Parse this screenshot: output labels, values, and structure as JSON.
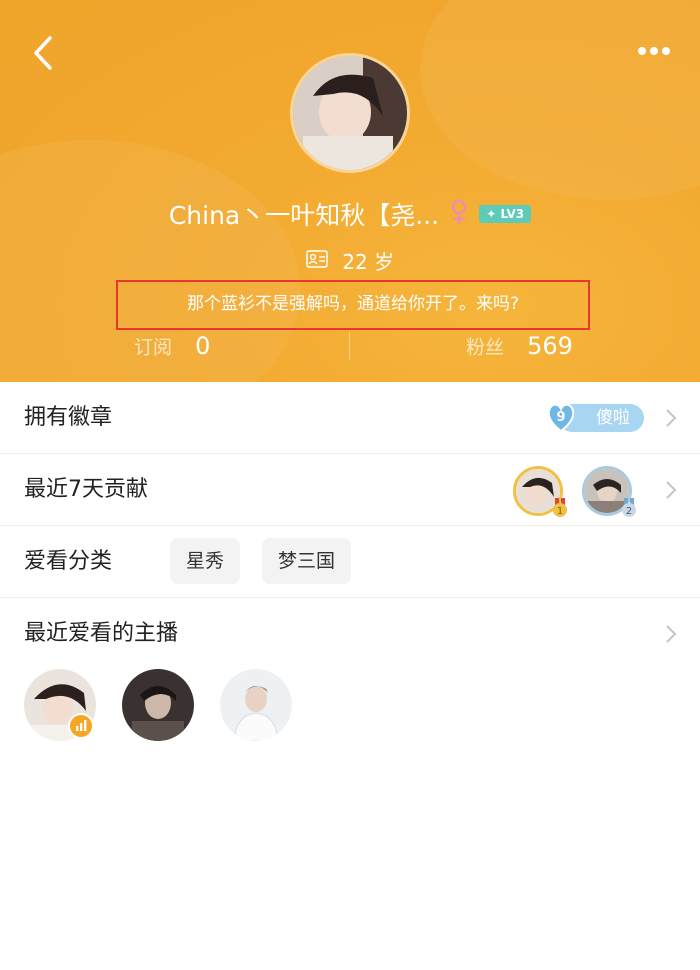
{
  "header": {
    "back_icon": "chevron-left-icon",
    "more_icon": "more-dots-icon",
    "name": "China丶一叶知秋【尧...",
    "gender_icon": "female-icon",
    "level": "LV3",
    "age": "22 岁",
    "signature": "那个蓝衫不是强解吗，通道给你开了。来吗?",
    "stats": {
      "subscribe_label": "订阅",
      "subscribe_value": "0",
      "fans_label": "粉丝",
      "fans_value": "569"
    },
    "colors": {
      "background": "#f3aa31",
      "signature_border": "#e8382b",
      "level_badge": "#5ecbb8"
    }
  },
  "rows": {
    "badges": {
      "label": "拥有徽章",
      "badge_text": "傻啦",
      "badge_level": "9"
    },
    "contrib": {
      "label": "最近7天贡献",
      "ranks": [
        "1",
        "2"
      ]
    },
    "categories": {
      "label": "爱看分类",
      "tags": [
        "星秀",
        "梦三国"
      ]
    },
    "anchors": {
      "label": "最近爱看的主播"
    }
  }
}
